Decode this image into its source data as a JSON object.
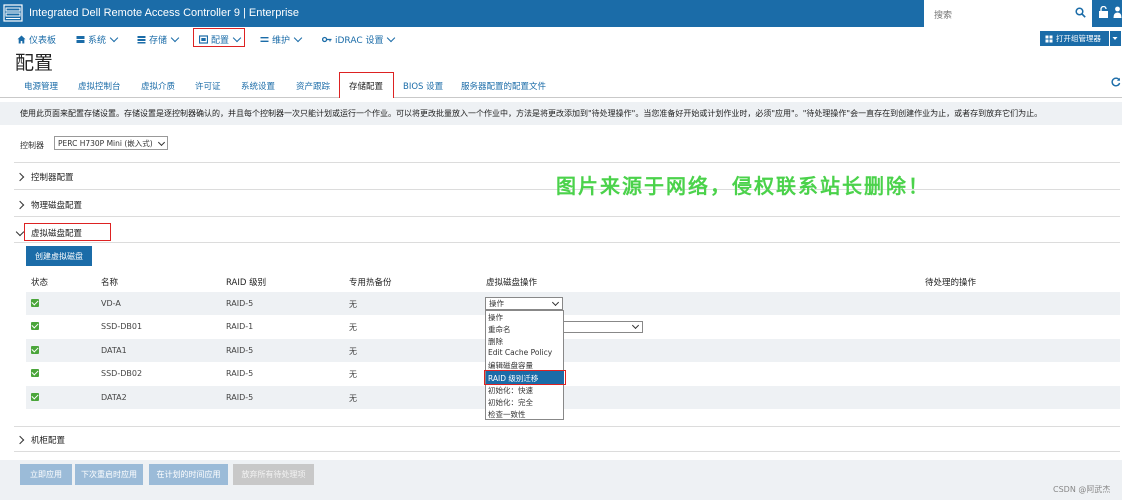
{
  "app": {
    "title": "Integrated Dell Remote Access Controller 9 | Enterprise"
  },
  "search": {
    "placeholder": "搜索"
  },
  "nav": [
    {
      "label": "仪表板",
      "icon": "home-icon"
    },
    {
      "label": "系统",
      "icon": "server-icon"
    },
    {
      "label": "存储",
      "icon": "storage-icon"
    },
    {
      "label": "配置",
      "icon": "config-icon"
    },
    {
      "label": "维护",
      "icon": "maintenance-icon"
    },
    {
      "label": "iDRAC 设置",
      "icon": "key-icon"
    }
  ],
  "group_button": {
    "label": "打开组管理器"
  },
  "page_title": "配置",
  "tabs": [
    "电源管理",
    "虚拟控制台",
    "虚拟介质",
    "许可证",
    "系统设置",
    "资产跟踪",
    "存储配置",
    "BIOS 设置",
    "服务器配置的配置文件"
  ],
  "description": "使用此页面来配置存储设置。存储设置是逐控制器确认的，并且每个控制器一次只能计划或运行一个作业。可以将更改批量放入一个作业中，方法是将更改添加到\"待处理操作\"。当您准备好开始或计划作业时，必须\"应用\"。\"待处理操作\"会一直存在到创建作业为止，或者存到放弃它们为止。",
  "controller": {
    "label": "控制器",
    "value": "PERC H730P Mini (嵌入式)"
  },
  "sections": {
    "controller": "控制器配置",
    "physical": "物理磁盘配置",
    "virtual": "虚拟磁盘配置",
    "enclosure": "机柜配置"
  },
  "create_button": "创建虚拟磁盘",
  "table": {
    "headers": [
      "状态",
      "名称",
      "RAID 级别",
      "专用热备份",
      "虚拟磁盘操作",
      "待处理的操作"
    ],
    "rows": [
      {
        "name": "VD-A",
        "raid": "RAID-5",
        "spare": "无"
      },
      {
        "name": "SSD-DB01",
        "raid": "RAID-1",
        "spare": "无"
      },
      {
        "name": "DATA1",
        "raid": "RAID-5",
        "spare": "无"
      },
      {
        "name": "SSD-DB02",
        "raid": "RAID-5",
        "spare": "无"
      },
      {
        "name": "DATA2",
        "raid": "RAID-5",
        "spare": "无"
      }
    ]
  },
  "operation_select": {
    "value": "操作"
  },
  "dropdown_options": [
    "操作",
    "重命名",
    "删除",
    "Edit Cache Policy",
    "编辑磁盘容量",
    "RAID 级别迁移",
    "初始化：快速",
    "初始化：完全",
    "检查一致性"
  ],
  "watermark": "图片来源于网络，侵权联系站长删除！",
  "footer_buttons": [
    "立即应用",
    "下次重启时应用",
    "在计划的时间应用",
    "放弃所有待处理项"
  ],
  "credit": "CSDN @阿武杰",
  "colors": {
    "brand": "#1b6ca8",
    "highlight": "#dd2222",
    "status_ok": "#4aa53a",
    "watermark": "#4bd24b"
  }
}
